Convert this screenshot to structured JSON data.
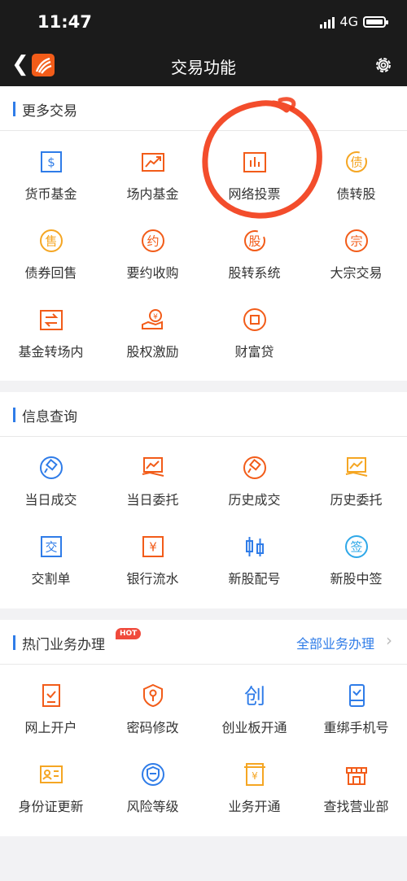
{
  "status": {
    "time": "11:47",
    "network": "4G"
  },
  "nav": {
    "title": "交易功能",
    "back_icon": "back-chevron-icon",
    "settings_icon": "gear-icon"
  },
  "colors": {
    "orange": "#f25c19",
    "blue": "#2f7ce8",
    "marker": "#f23a15"
  },
  "sections": [
    {
      "title": "更多交易",
      "items": [
        {
          "label": "货币基金",
          "icon": "dollar-square-icon",
          "color": "#2f7ce8"
        },
        {
          "label": "场内基金",
          "icon": "trend-chart-icon",
          "color": "#f25c19"
        },
        {
          "label": "网络投票",
          "icon": "bar-chart-icon",
          "color": "#f25c19"
        },
        {
          "label": "债转股",
          "icon": "debt-convert-icon",
          "color": "#f5a623"
        },
        {
          "label": "债券回售",
          "icon": "sell-circle-icon",
          "color": "#f5a623"
        },
        {
          "label": "要约收购",
          "icon": "offer-circle-icon",
          "color": "#f25c19"
        },
        {
          "label": "股转系统",
          "icon": "share-circle-icon",
          "color": "#f25c19"
        },
        {
          "label": "大宗交易",
          "icon": "bulk-circle-icon",
          "color": "#f25c19"
        },
        {
          "label": "基金转场内",
          "icon": "transfer-arrows-icon",
          "color": "#f25c19"
        },
        {
          "label": "股权激励",
          "icon": "hand-coin-icon",
          "color": "#f25c19"
        },
        {
          "label": "财富贷",
          "icon": "coin-loan-icon",
          "color": "#f25c19"
        }
      ]
    },
    {
      "title": "信息查询",
      "items": [
        {
          "label": "当日成交",
          "icon": "gavel-circle-icon",
          "color": "#2f7ce8"
        },
        {
          "label": "当日委托",
          "icon": "hand-chart-icon",
          "color": "#f25c19"
        },
        {
          "label": "历史成交",
          "icon": "gavel-circle-icon",
          "color": "#f25c19"
        },
        {
          "label": "历史委托",
          "icon": "hand-chart-icon",
          "color": "#f5a623"
        },
        {
          "label": "交割单",
          "icon": "delivery-square-icon",
          "color": "#2f7ce8"
        },
        {
          "label": "银行流水",
          "icon": "yen-square-icon",
          "color": "#f25c19"
        },
        {
          "label": "新股配号",
          "icon": "candlestick-icon",
          "color": "#2f7ce8"
        },
        {
          "label": "新股中签",
          "icon": "sign-circle-icon",
          "color": "#2fa8e8"
        }
      ]
    },
    {
      "title": "热门业务办理",
      "badge": "HOT",
      "link": "全部业务办理",
      "items": [
        {
          "label": "网上开户",
          "icon": "open-account-icon",
          "color": "#f25c19"
        },
        {
          "label": "密码修改",
          "icon": "key-shield-icon",
          "color": "#f25c19"
        },
        {
          "label": "创业板开通",
          "icon": "chuang-char-icon",
          "color": "#2f7ce8"
        },
        {
          "label": "重绑手机号",
          "icon": "phone-icon",
          "color": "#2f7ce8"
        },
        {
          "label": "身份证更新",
          "icon": "id-card-icon",
          "color": "#f5a623"
        },
        {
          "label": "风险等级",
          "icon": "risk-shield-icon",
          "color": "#2f7ce8"
        },
        {
          "label": "业务开通",
          "icon": "yen-document-icon",
          "color": "#f5a623"
        },
        {
          "label": "查找营业部",
          "icon": "storefront-icon",
          "color": "#f25c19"
        }
      ]
    }
  ]
}
